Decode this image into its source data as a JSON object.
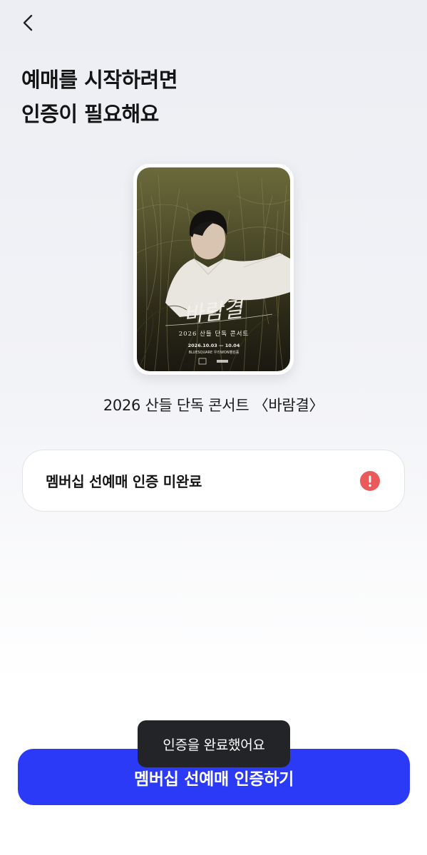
{
  "header": {
    "back_icon": "chevron-left-icon"
  },
  "heading": {
    "line1": "예매를 시작하려면",
    "line2": "인증이 필요해요"
  },
  "poster": {
    "script_title": "바람결",
    "subtitle": "2026 산들 단독 콘서트",
    "dates": "2026.10.03 — 10.04",
    "venue": "BLUESQUARE 우리WON뱅킹홀"
  },
  "concert": {
    "title": "2026 산들 단독 콘서트 〈바람결〉"
  },
  "status": {
    "label": "멤버십 선예매 인증 미완료",
    "icon": "alert-icon",
    "icon_color": "#ea5a5a"
  },
  "toast": {
    "message": "인증을 완료했어요"
  },
  "cta": {
    "label": "멤버십 선예매 인증하기",
    "color": "#2b3af6"
  }
}
